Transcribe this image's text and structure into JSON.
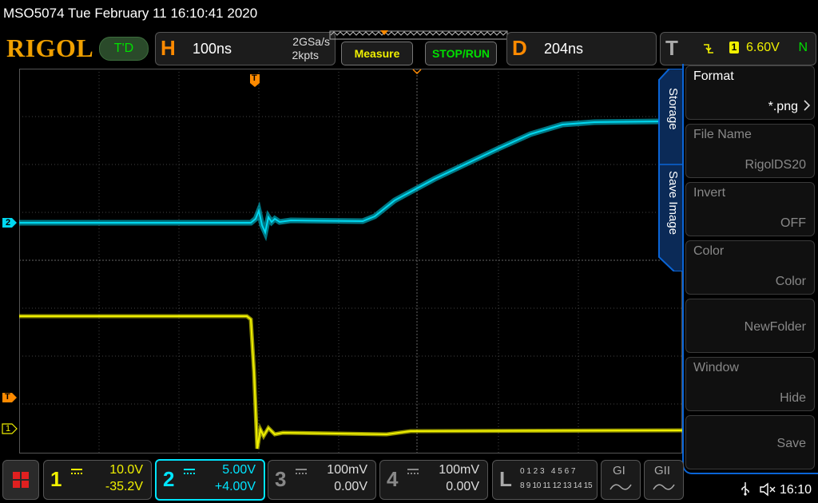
{
  "header": {
    "title": "MSO5074  Tue February 11 16:10:41 2020",
    "logo": "RIGOL",
    "trigger_status": "T'D",
    "horizontal": {
      "letter": "H",
      "timebase": "100ns",
      "sample_rate": "2GSa/s",
      "memory_depth": "2kpts"
    },
    "measure_label": "Measure",
    "stoprun_label": "STOP/RUN",
    "delay": {
      "letter": "D",
      "value": "204ns"
    },
    "trigger": {
      "letter": "T",
      "source": "1",
      "level": "6.60V",
      "mode": "N"
    }
  },
  "markers": {
    "trigger_top": "T",
    "ch2": "2",
    "trigger_left": "T",
    "ch1": "1"
  },
  "side_menu": {
    "tabs": [
      "Storage",
      "Save Image"
    ],
    "items": [
      {
        "label": "Format",
        "value": "*.png"
      },
      {
        "label": "File Name",
        "value": "RigolDS20"
      },
      {
        "label": "Invert",
        "value": "OFF"
      },
      {
        "label": "Color",
        "value": "Color"
      },
      {
        "label": "",
        "value": "NewFolder"
      },
      {
        "label": "Window",
        "value": "Hide"
      },
      {
        "label": "",
        "value": "Save"
      }
    ]
  },
  "channels": [
    {
      "num": "1",
      "scale": "10.0V",
      "offset": "-35.2V",
      "color": "#f0f000",
      "active": true
    },
    {
      "num": "2",
      "scale": "5.00V",
      "offset": "+4.00V",
      "color": "#00e5ff",
      "active": true
    },
    {
      "num": "3",
      "scale": "100mV",
      "offset": "0.00V",
      "color": "#888888",
      "active": false
    },
    {
      "num": "4",
      "scale": "100mV",
      "offset": "0.00V",
      "color": "#888888",
      "active": false
    }
  ],
  "logic": {
    "letter": "L",
    "row1": "0 1 2 3   4 5 6 7",
    "row2": "8 9 10 11 12 13 14 15"
  },
  "decoders": [
    "GI",
    "GII"
  ],
  "status": {
    "time": "16:10"
  },
  "colors": {
    "accent": "#ff8a00",
    "ch1": "#f0f000",
    "ch2": "#00e5ff",
    "menu_border": "#0a64d6"
  }
}
